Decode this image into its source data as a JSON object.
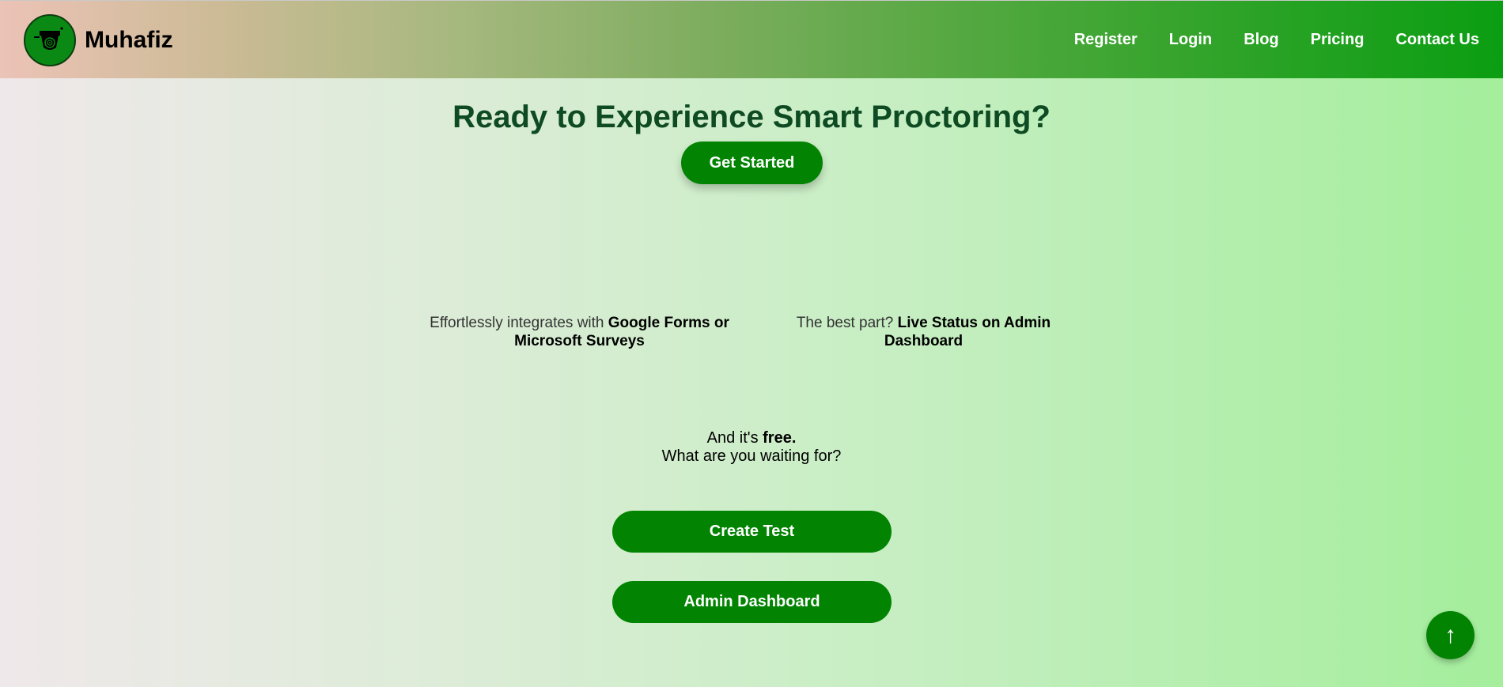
{
  "brand": {
    "name": "Muhafiz",
    "logo_icon": "cctv-camera-icon"
  },
  "nav": {
    "items": [
      "Register",
      "Login",
      "Blog",
      "Pricing",
      "Contact Us"
    ]
  },
  "hero": {
    "title": "Ready to Experience Smart Proctoring?",
    "cta_label": "Get Started"
  },
  "features": [
    {
      "prefix": "Effortlessly integrates with ",
      "highlight": "Google Forms or Microsoft Surveys"
    },
    {
      "prefix": "The best part? ",
      "highlight": "Live Status on Admin Dashboard"
    }
  ],
  "free_note": {
    "prefix": "And it's ",
    "highlight": "free.",
    "line2": "What are you waiting for?"
  },
  "actions": {
    "create_test": "Create Test",
    "admin_dashboard": "Admin Dashboard"
  },
  "scroll_top": {
    "icon": "arrow-up-icon",
    "glyph": "↑"
  },
  "colors": {
    "accent": "#028402",
    "title": "#0e4a22"
  }
}
